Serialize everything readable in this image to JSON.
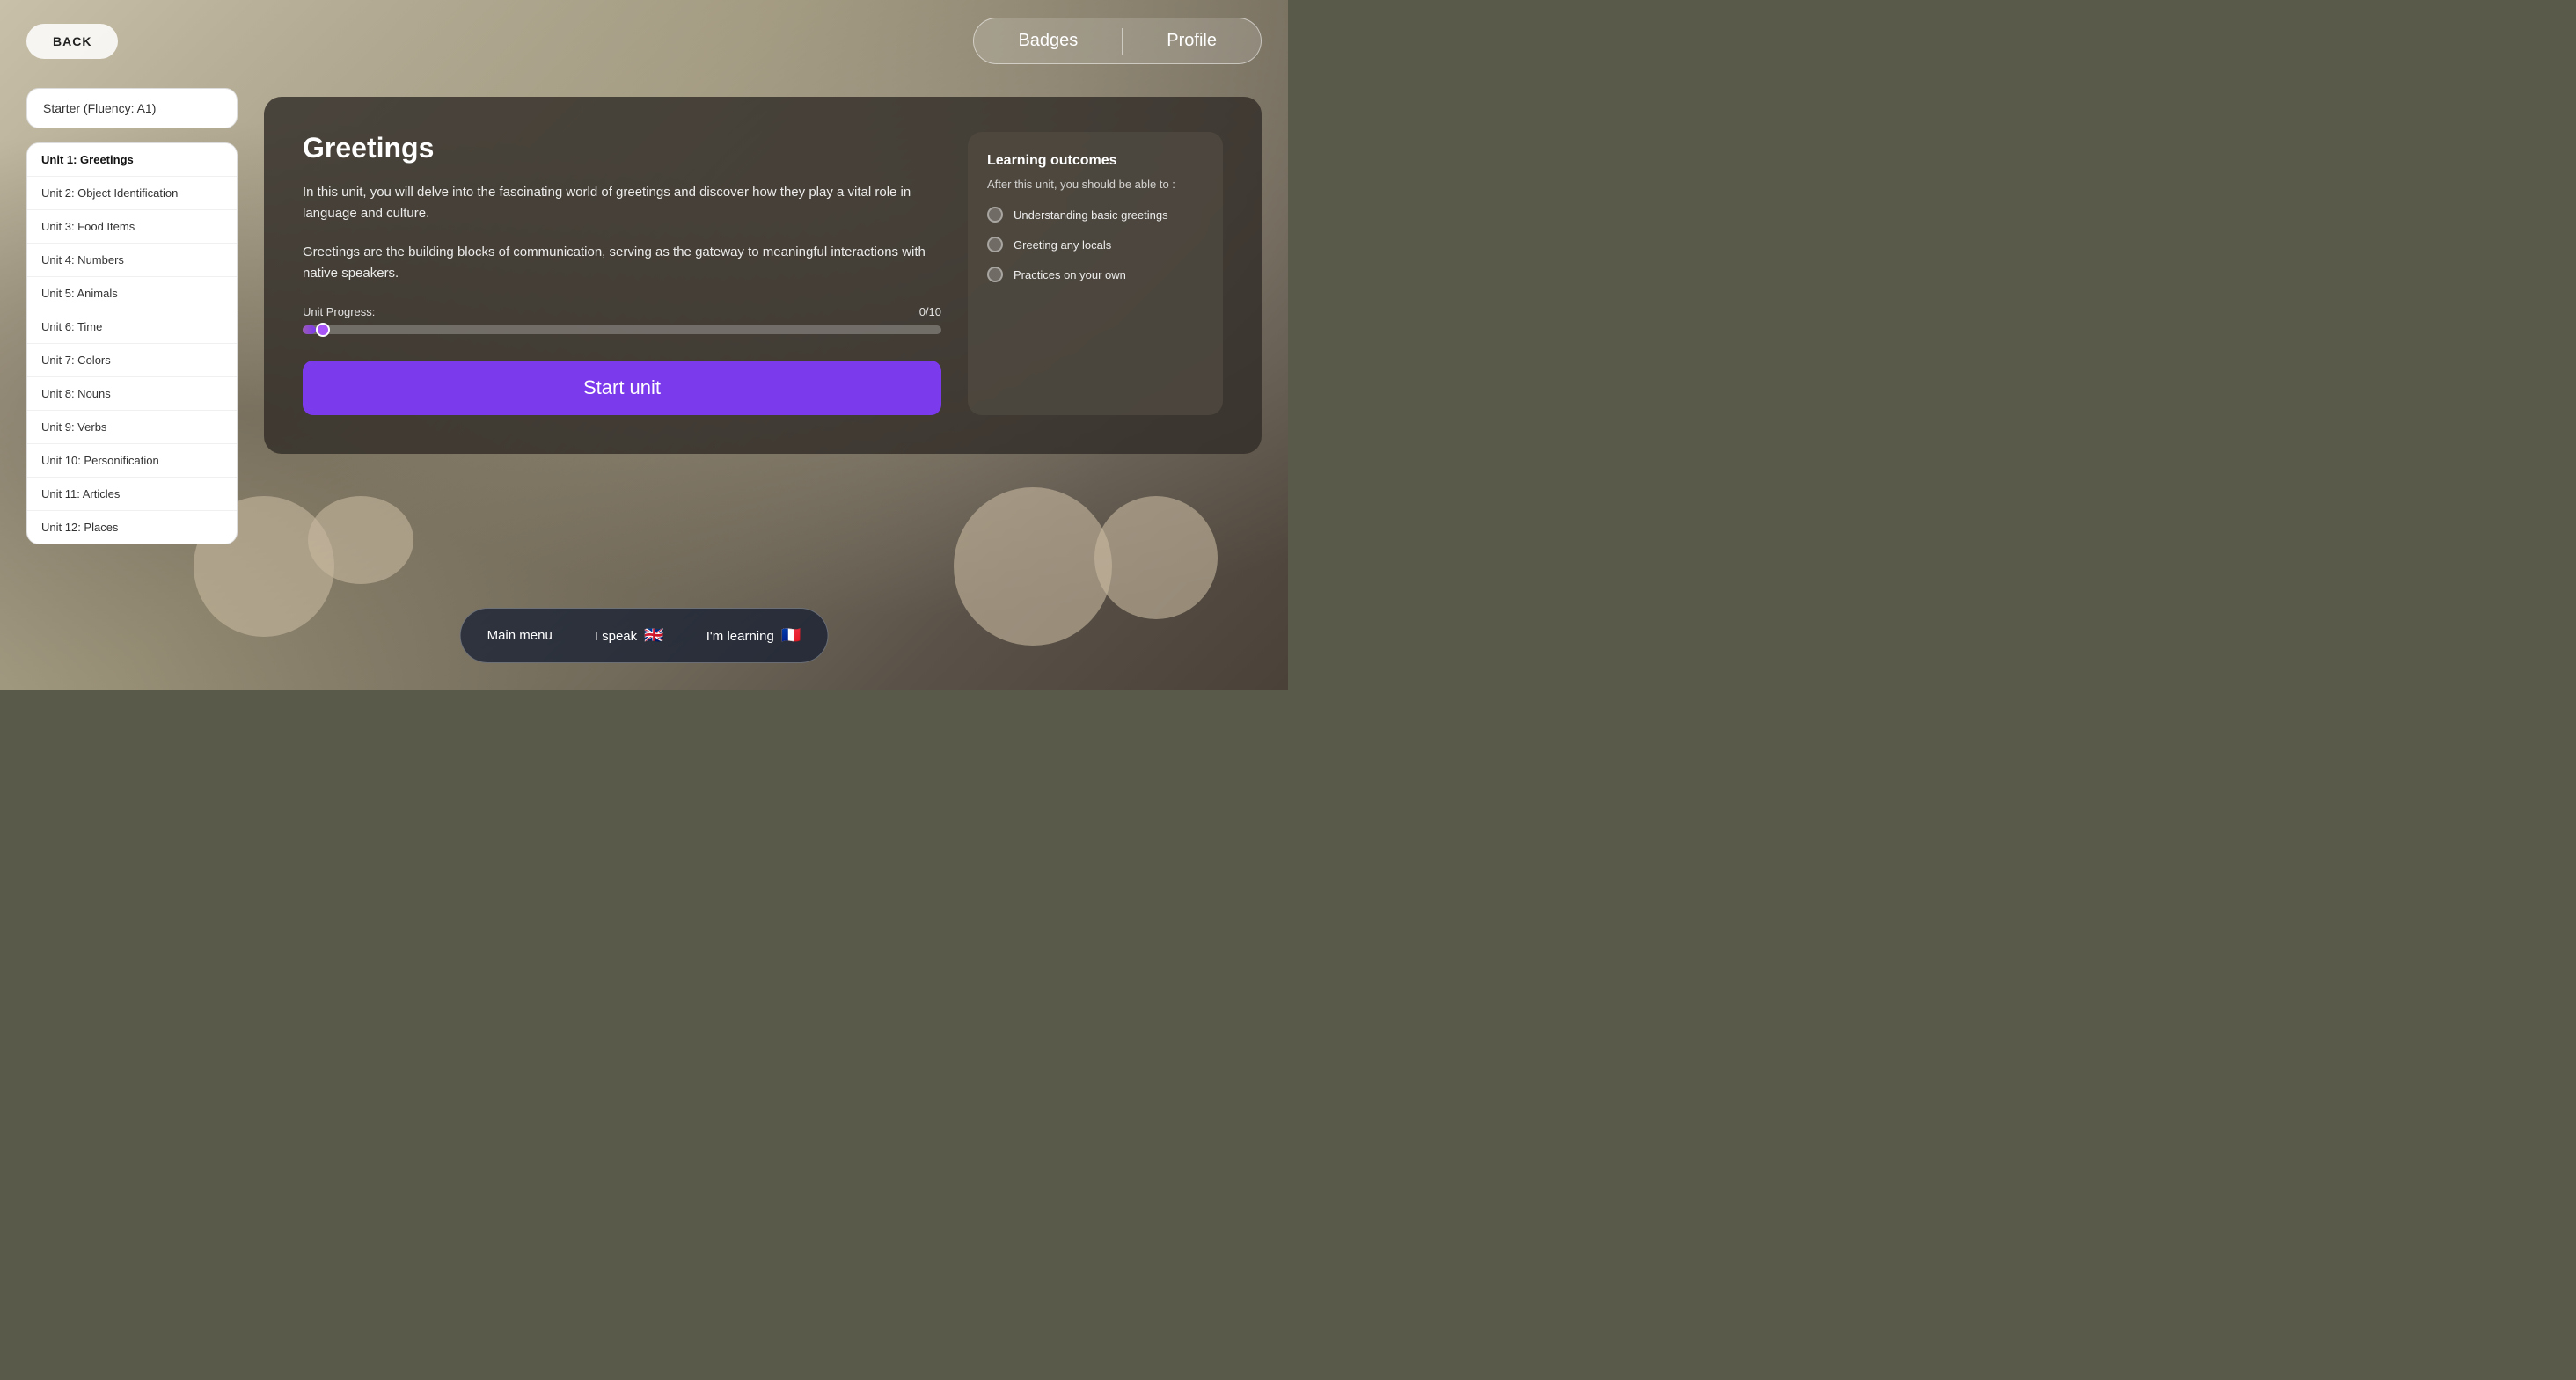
{
  "nav": {
    "back_label": "BACK",
    "badges_label": "Badges",
    "profile_label": "Profile"
  },
  "sidebar": {
    "fluency_label": "Starter (Fluency: A1)",
    "units": [
      {
        "id": 1,
        "label": "Unit 1: Greetings",
        "active": true
      },
      {
        "id": 2,
        "label": "Unit 2: Object Identification",
        "active": false
      },
      {
        "id": 3,
        "label": "Unit 3: Food Items",
        "active": false
      },
      {
        "id": 4,
        "label": "Unit 4: Numbers",
        "active": false
      },
      {
        "id": 5,
        "label": "Unit 5: Animals",
        "active": false
      },
      {
        "id": 6,
        "label": "Unit 6: Time",
        "active": false
      },
      {
        "id": 7,
        "label": "Unit 7: Colors",
        "active": false
      },
      {
        "id": 8,
        "label": "Unit 8: Nouns",
        "active": false
      },
      {
        "id": 9,
        "label": "Unit 9: Verbs",
        "active": false
      },
      {
        "id": 10,
        "label": "Unit 10: Personification",
        "active": false
      },
      {
        "id": 11,
        "label": "Unit 11: Articles",
        "active": false
      },
      {
        "id": 12,
        "label": "Unit 12: Places",
        "active": false
      }
    ]
  },
  "main": {
    "title": "Greetings",
    "description_1": "In this unit, you will delve into the fascinating world of greetings and discover how they play a vital role in language and culture.",
    "description_2": "Greetings are the building blocks of communication, serving as the gateway to meaningful interactions with native speakers.",
    "progress_label": "Unit Progress:",
    "progress_value": "0/10",
    "start_button_label": "Start unit"
  },
  "outcomes": {
    "title": "Learning outcomes",
    "subtitle": "After this unit, you should be able to :",
    "items": [
      {
        "label": "Understanding basic greetings"
      },
      {
        "label": "Greeting any locals"
      },
      {
        "label": "Practices on your own"
      }
    ]
  },
  "bottom_bar": {
    "main_menu_label": "Main menu",
    "i_speak_label": "I speak",
    "i_speak_flag": "🇬🇧",
    "im_learning_label": "I'm learning",
    "im_learning_flag": "🇫🇷"
  }
}
